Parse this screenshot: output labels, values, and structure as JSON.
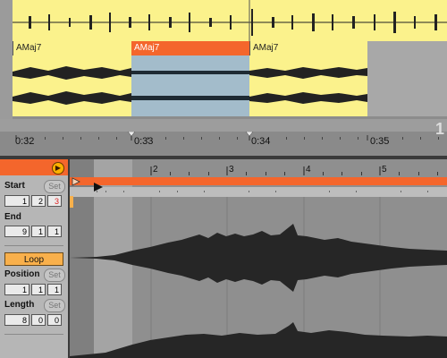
{
  "arrangement": {
    "clips": [
      {
        "name": "AMaj7",
        "color": "#fbf28c"
      },
      {
        "name": "AMaj7",
        "color": "#f4662c",
        "selected": true
      },
      {
        "name": "AMaj7",
        "color": "#fbf28c"
      }
    ],
    "ruler": {
      "times": [
        "0:32",
        "0:33",
        "0:34",
        "0:35"
      ],
      "loop_marker": "1"
    }
  },
  "clip_view": {
    "start": {
      "label": "Start",
      "set": "Set",
      "values": [
        "1",
        "2",
        "3"
      ]
    },
    "end": {
      "label": "End",
      "values": [
        "9",
        "1",
        "1"
      ]
    },
    "loop": {
      "label": "Loop",
      "active": true
    },
    "position": {
      "label": "Position",
      "set": "Set",
      "values": [
        "1",
        "1",
        "1"
      ]
    },
    "length": {
      "label": "Length",
      "set": "Set",
      "values": [
        "8",
        "0",
        "0"
      ]
    },
    "bar_numbers": [
      "2",
      "3",
      "4",
      "5"
    ]
  },
  "colors": {
    "accent": "#f4662c",
    "clip_yellow": "#fbf28c",
    "loop_orange": "#f9b04b"
  }
}
